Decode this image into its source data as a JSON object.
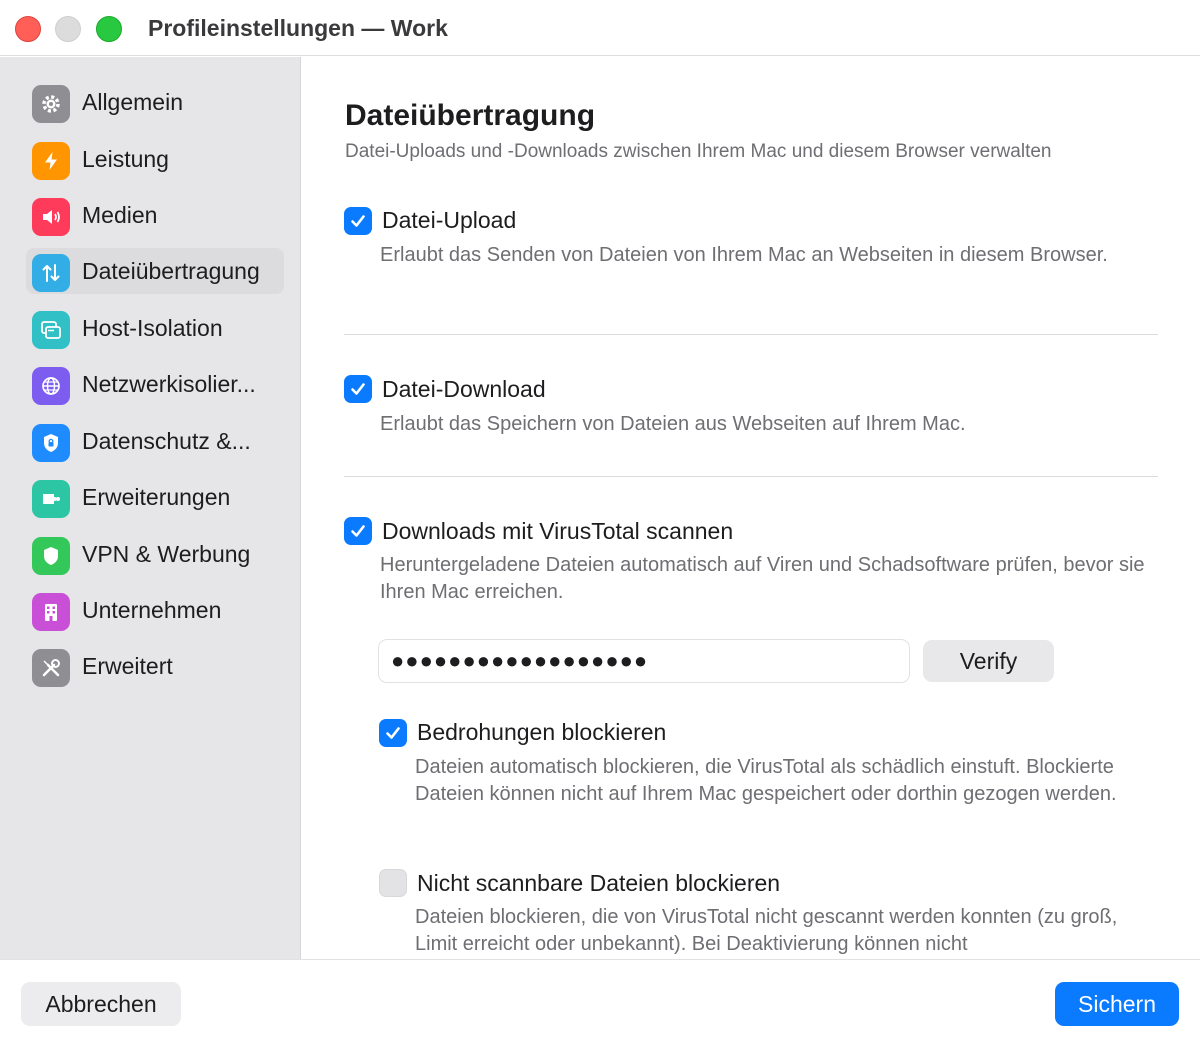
{
  "window": {
    "title": "Profileinstellungen — Work"
  },
  "sidebar": {
    "items": [
      {
        "label": "Allgemein",
        "icon": "gear-icon",
        "color": "#8e8e93"
      },
      {
        "label": "Leistung",
        "icon": "bolt-icon",
        "color": "#ff9500"
      },
      {
        "label": "Medien",
        "icon": "speaker-icon",
        "color": "#ff3b5c"
      },
      {
        "label": "Dateiübertragung",
        "icon": "transfer-arrows-icon",
        "color": "#32ade6",
        "selected": true
      },
      {
        "label": "Host-Isolation",
        "icon": "windows-icon",
        "color": "#30c0c6"
      },
      {
        "label": "Netzwerkisolier...",
        "icon": "globe-icon",
        "color": "#7d5cf0"
      },
      {
        "label": "Datenschutz &...",
        "icon": "lock-shield-icon",
        "color": "#1e8cff"
      },
      {
        "label": "Erweiterungen",
        "icon": "puzzle-icon",
        "color": "#2dc6a4"
      },
      {
        "label": "VPN & Werbung",
        "icon": "shield-icon",
        "color": "#34c759"
      },
      {
        "label": "Unternehmen",
        "icon": "building-icon",
        "color": "#c950d6"
      },
      {
        "label": "Erweitert",
        "icon": "tools-icon",
        "color": "#8e8e93"
      }
    ]
  },
  "main": {
    "title": "Dateiübertragung",
    "subtitle": "Datei-Uploads und -Downloads zwischen Ihrem Mac und diesem Browser verwalten",
    "options": [
      {
        "label": "Datei-Upload",
        "checked": true,
        "description": "Erlaubt das Senden von Dateien von Ihrem Mac an Webseiten in diesem Browser."
      },
      {
        "label": "Datei-Download",
        "checked": true,
        "description": "Erlaubt das Speichern von Dateien aus Webseiten auf Ihrem Mac."
      },
      {
        "label": "Downloads mit VirusTotal scannen",
        "checked": true,
        "description": "Heruntergeladene Dateien automatisch auf Viren und Schadsoftware prüfen, bevor sie Ihren Mac erreichen."
      }
    ],
    "api_key": {
      "value": "●●●●●●●●●●●●●●●●●●"
    },
    "verify_label": "Verify",
    "sub_options": [
      {
        "label": "Bedrohungen blockieren",
        "checked": true,
        "description": "Dateien automatisch blockieren, die VirusTotal als schädlich einstuft. Blockierte Dateien können nicht auf Ihrem Mac gespeichert oder dorthin gezogen werden."
      },
      {
        "label": "Nicht scannbare Dateien blockieren",
        "checked": false,
        "description": "Dateien blockieren, die von VirusTotal nicht gescannt werden konnten (zu groß, Limit erreicht oder unbekannt). Bei Deaktivierung können nicht"
      }
    ]
  },
  "footer": {
    "cancel_label": "Abbrechen",
    "save_label": "Sichern"
  }
}
